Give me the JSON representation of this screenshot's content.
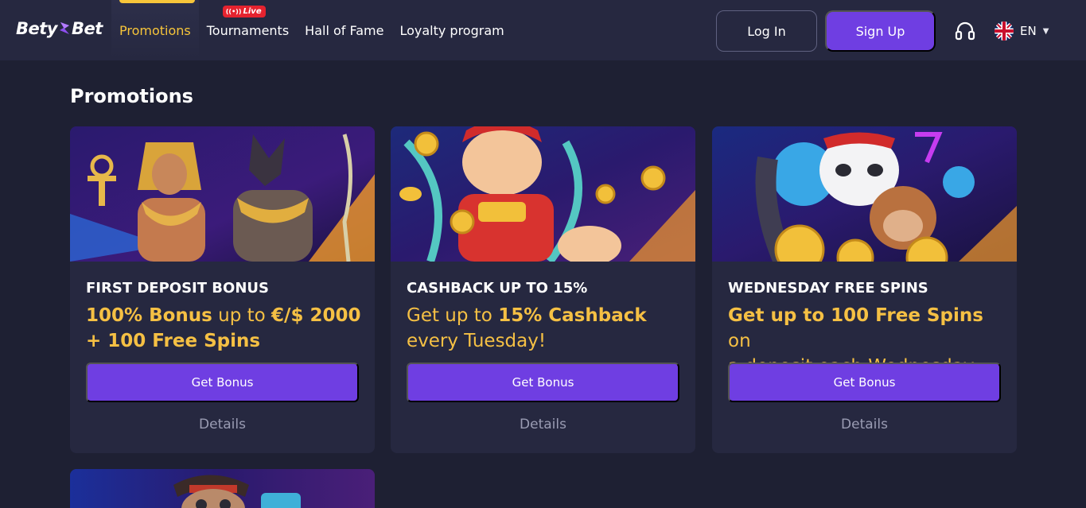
{
  "header": {
    "logo": {
      "left": "Bety",
      "right": "Bet"
    },
    "nav": [
      {
        "label": "Promotions",
        "active": true
      },
      {
        "label": "Tournaments",
        "badge": "Live"
      },
      {
        "label": "Hall of Fame"
      },
      {
        "label": "Loyalty program"
      }
    ],
    "login_label": "Log In",
    "signup_label": "Sign Up",
    "support_icon": "headset-icon",
    "language": {
      "code": "EN",
      "flag": "uk-flag-icon"
    }
  },
  "main": {
    "title": "Promotions",
    "cards": [
      {
        "title": "FIRST DEPOSIT BONUS",
        "desc_parts": [
          "100% Bonus",
          " up to ",
          "€/$ 2000",
          "+ 100 Free Spins"
        ],
        "button_label": "Get Bonus",
        "details_label": "Details",
        "image": "egyptian-pharaoh-anubis-art"
      },
      {
        "title": "CASHBACK UP TO 15%",
        "desc_parts": [
          "Get up to ",
          "15% Cashback",
          "every Tuesday!"
        ],
        "button_label": "Get Bonus",
        "details_label": "Details",
        "image": "fortune-god-gold-coins-art"
      },
      {
        "title": "WEDNESDAY FREE SPINS",
        "desc_parts": [
          "Get up to 100 Free Spins",
          " on",
          "a deposit each Wednesday."
        ],
        "button_label": "Get Bonus",
        "details_label": "Details",
        "image": "panda-monkey-lucky-seven-art"
      }
    ],
    "partial_card_image": "pirate-character-art"
  },
  "colors": {
    "background": "#1e2033",
    "header": "#262840",
    "card": "#262840",
    "accent_purple": "#6f3ee2",
    "highlight_gold": "#f5c044",
    "live_red": "#e5232f",
    "muted_text": "#9a9cb3"
  }
}
